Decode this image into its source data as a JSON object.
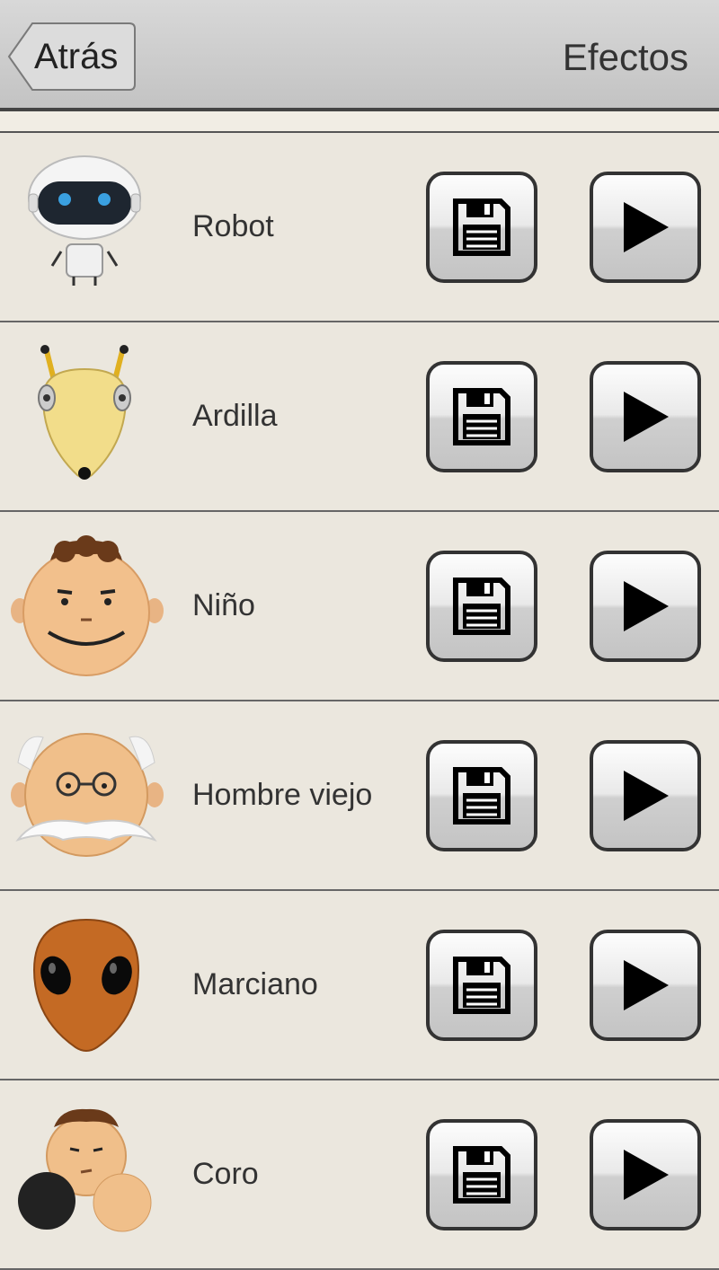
{
  "header": {
    "back_label": "Atrás",
    "title": "Efectos"
  },
  "effects": [
    {
      "label": "Robot",
      "icon": "robot-icon"
    },
    {
      "label": "Ardilla",
      "icon": "squirrel-icon"
    },
    {
      "label": "Niño",
      "icon": "boy-icon"
    },
    {
      "label": "Hombre viejo",
      "icon": "old-man-icon"
    },
    {
      "label": "Marciano",
      "icon": "martian-icon"
    },
    {
      "label": "Coro",
      "icon": "choir-icon"
    }
  ],
  "buttons": {
    "save_icon": "floppy-disk-icon",
    "play_icon": "play-icon"
  },
  "colors": {
    "header_bg": "#c8c8c8",
    "row_bg": "#ebe7de",
    "divider": "#666666"
  }
}
